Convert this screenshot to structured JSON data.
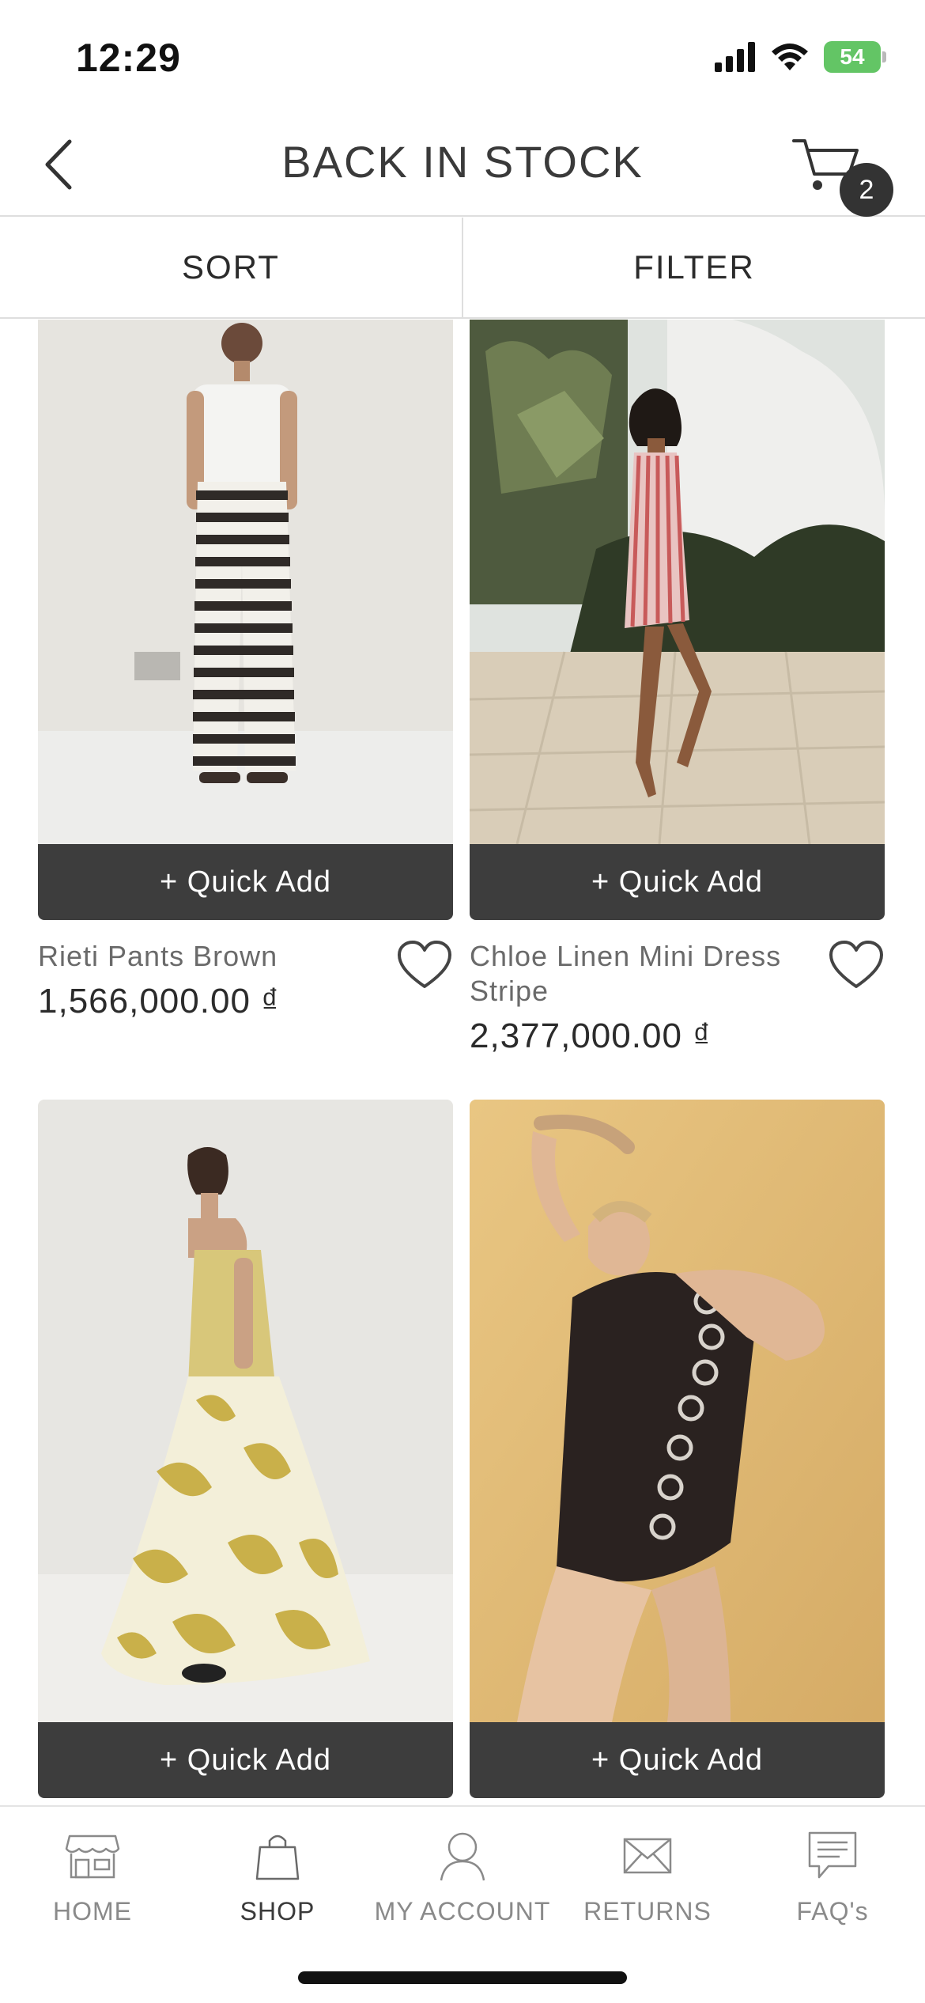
{
  "status_bar": {
    "time": "12:29",
    "battery": "54"
  },
  "header": {
    "title": "BACK IN STOCK",
    "cart_count": "2"
  },
  "toolbar": {
    "sort_label": "SORT",
    "filter_label": "FILTER"
  },
  "products": [
    {
      "name": "Rieti Pants Brown",
      "price": "1,566,000.00 ₫",
      "quick_add": "+ Quick Add"
    },
    {
      "name": "Chloe Linen Mini Dress Stripe",
      "price": "2,377,000.00 ₫",
      "quick_add": "+ Quick Add"
    },
    {
      "name": "",
      "price": "",
      "quick_add": "+ Quick Add"
    },
    {
      "name": "",
      "price": "",
      "quick_add": "+ Quick Add"
    }
  ],
  "bottom_nav": {
    "items": [
      {
        "label": "HOME",
        "icon": "store-icon"
      },
      {
        "label": "SHOP",
        "icon": "shopping-bag-icon",
        "active": true
      },
      {
        "label": "MY ACCOUNT",
        "icon": "user-icon"
      },
      {
        "label": "RETURNS",
        "icon": "envelope-icon"
      },
      {
        "label": "FAQ's",
        "icon": "chat-icon"
      }
    ]
  }
}
